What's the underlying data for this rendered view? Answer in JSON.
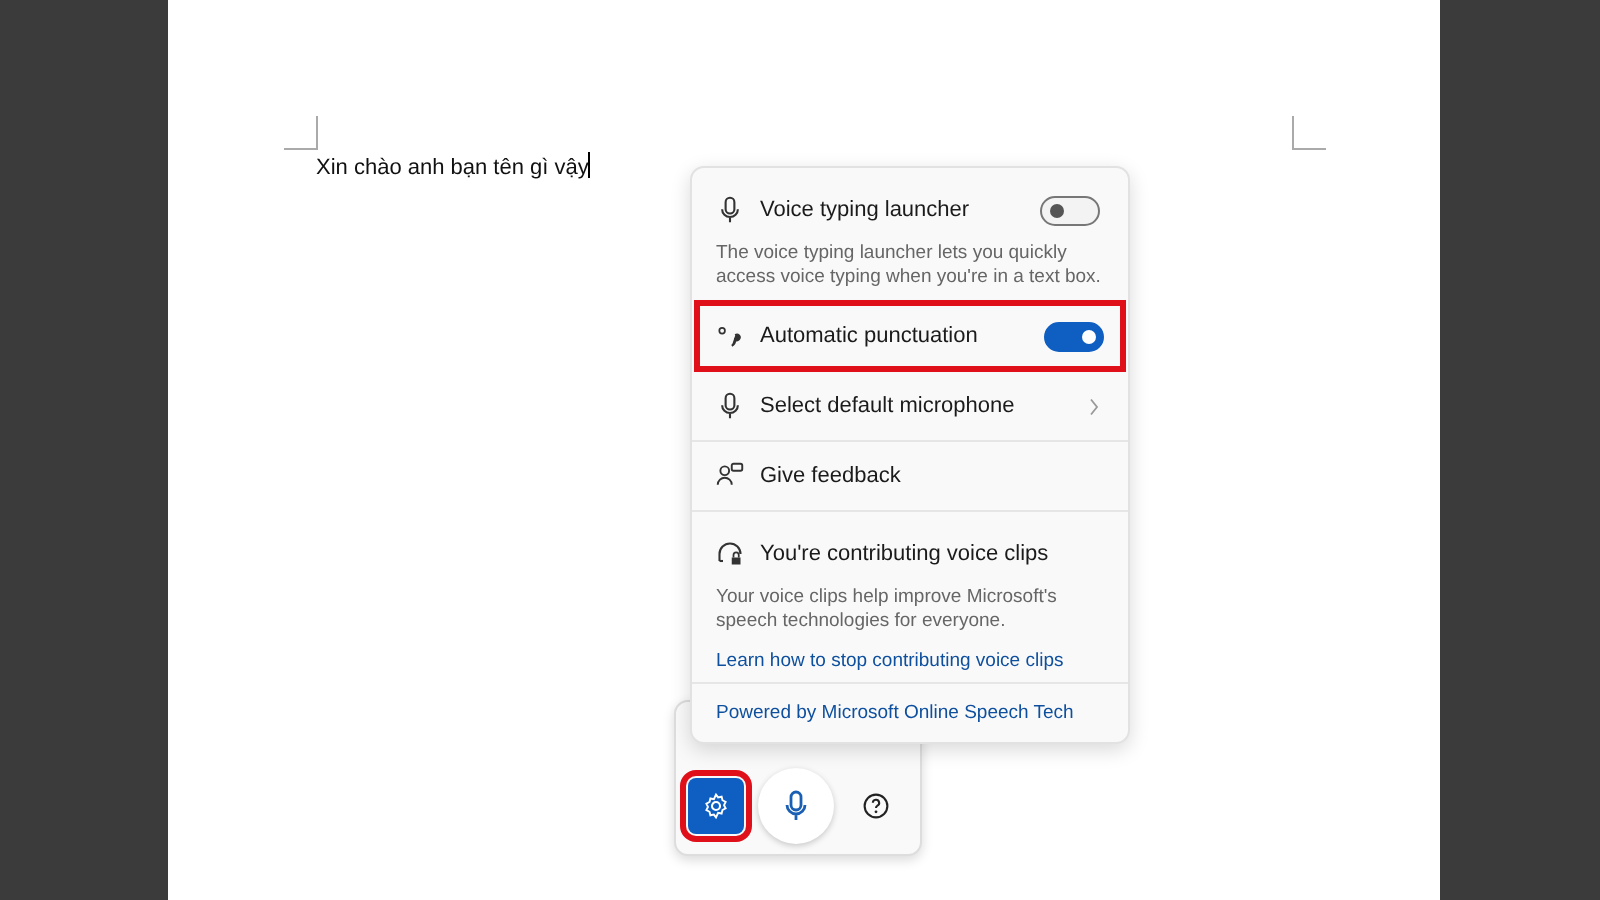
{
  "document": {
    "text": "Xin chào anh bạn tên gì vậy"
  },
  "voice_menu": {
    "items": [
      {
        "kind": "toggle",
        "label": "Voice typing launcher",
        "on": false,
        "highlighted": false,
        "description": "The voice typing launcher lets you quickly access voice typing when you're in a text box."
      },
      {
        "kind": "toggle",
        "label": "Automatic punctuation",
        "on": true,
        "highlighted": true
      },
      {
        "kind": "submenu",
        "label": "Select default microphone"
      },
      {
        "kind": "action",
        "label": "Give feedback"
      },
      {
        "kind": "info",
        "label": "You're contributing voice clips",
        "description": "Your voice clips help improve Microsoft's speech technologies for everyone.",
        "link": "Learn how to stop contributing voice clips"
      },
      {
        "kind": "footer",
        "link": "Powered by Microsoft Online Speech Tech"
      }
    ]
  },
  "toolbar": {
    "buttons": [
      {
        "kind": "settings",
        "selected": true,
        "highlighted": true
      },
      {
        "kind": "mic",
        "selected": false,
        "highlighted": false
      },
      {
        "kind": "help",
        "selected": false,
        "highlighted": false
      }
    ]
  }
}
